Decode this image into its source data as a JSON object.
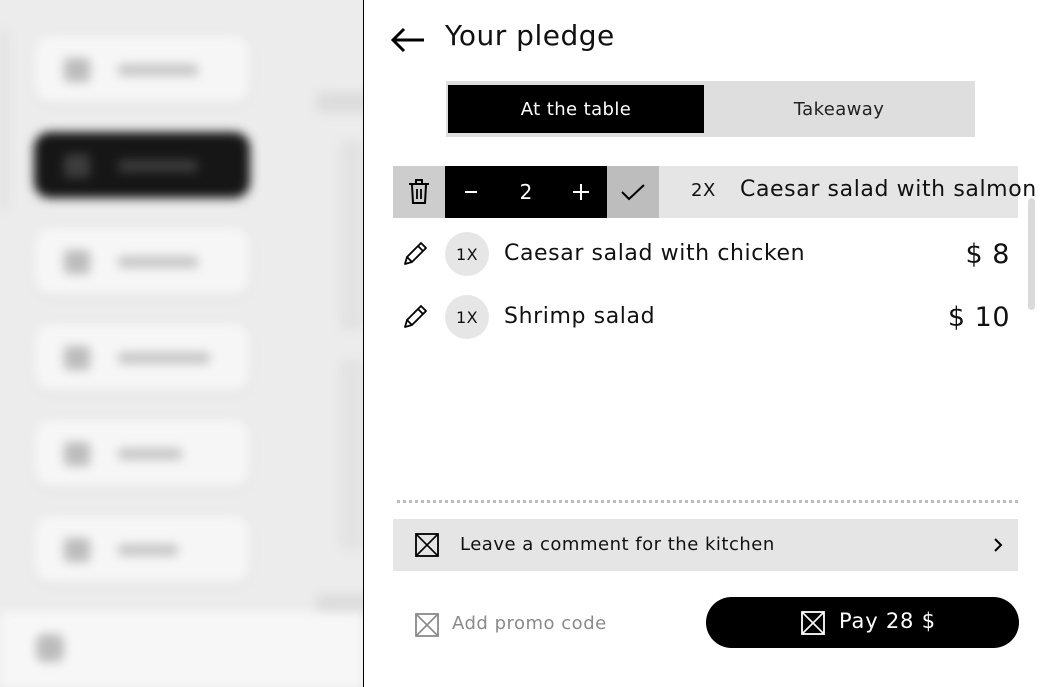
{
  "panel": {
    "title": "Your pledge",
    "back_icon": "arrow-left-icon"
  },
  "order_type": {
    "options": [
      "At the table",
      "Takeaway"
    ],
    "selected": "At the table"
  },
  "editing_item": {
    "quantity": "2",
    "count_label": "2X",
    "name": "Caesar salad with salmon"
  },
  "items": [
    {
      "count_label": "1X",
      "name": "Caesar salad with chicken",
      "price": "$ 8"
    },
    {
      "count_label": "1X",
      "name": "Shrimp salad",
      "price": "$ 10"
    }
  ],
  "comment": {
    "label": "Leave a comment for the kitchen"
  },
  "promo": {
    "label": "Add promo code"
  },
  "pay": {
    "label": "Pay 28 $"
  },
  "colors": {
    "accent": "#000000",
    "row_background": "#e5e5e5",
    "confirm_background": "#bdbdbd",
    "muted_text": "#8a8a8a"
  }
}
